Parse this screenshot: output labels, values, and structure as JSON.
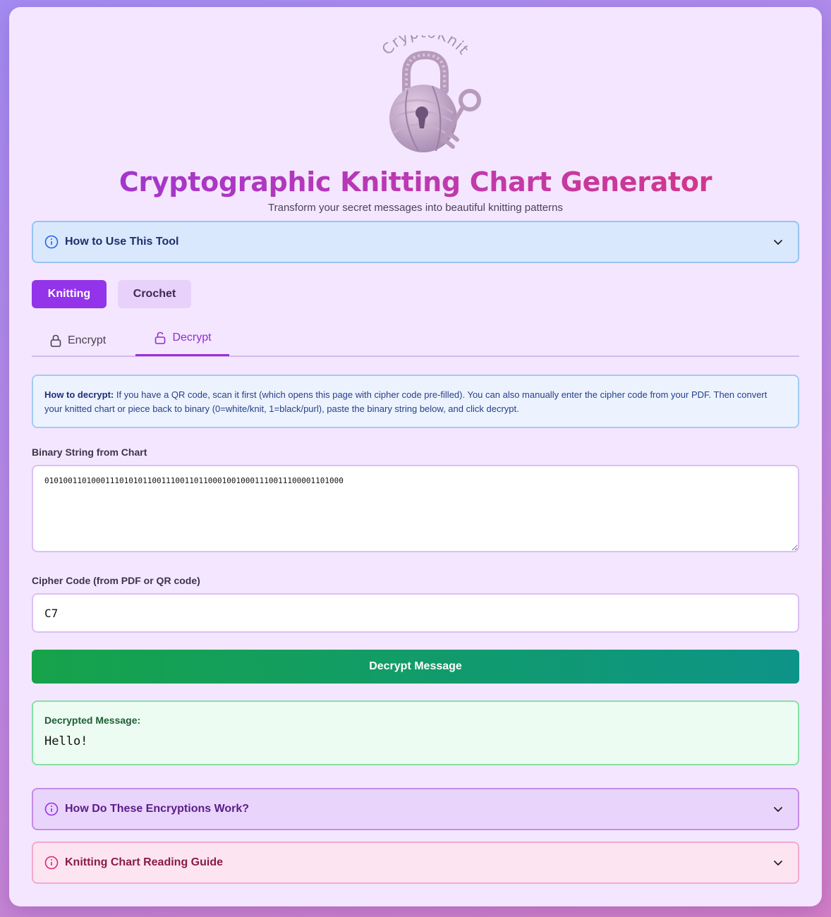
{
  "logo": {
    "text": "CryptoKnit"
  },
  "header": {
    "title": "Cryptographic Knitting Chart Generator",
    "subtitle": "Transform your secret messages into beautiful knitting patterns"
  },
  "how_to_use": {
    "label": "How to Use This Tool",
    "icon": "info-icon"
  },
  "modes": {
    "knitting": "Knitting",
    "crochet": "Crochet",
    "selected": "Knitting"
  },
  "tabs": {
    "encrypt": {
      "label": "Encrypt",
      "icon": "lock-icon"
    },
    "decrypt": {
      "label": "Decrypt",
      "icon": "unlock-icon"
    },
    "active": "Decrypt"
  },
  "help": {
    "title": "How to decrypt:",
    "text": "If you have a QR code, scan it first (which opens this page with cipher code pre-filled). You can also manually enter the cipher code from your PDF. Then convert your knitted chart or piece back to binary (0=white/knit, 1=black/purl), paste the binary string below, and click decrypt."
  },
  "binary_field": {
    "label": "Binary String from Chart",
    "value": "0101001101000111010101100111001101100010010001110011100001101000"
  },
  "cipher_field": {
    "label": "Cipher Code (from PDF or QR code)",
    "value": "C7"
  },
  "decrypt_button": {
    "label": "Decrypt Message"
  },
  "result": {
    "label": "Decrypted Message:",
    "value": "Hello!"
  },
  "how_encryptions_work": {
    "label": "How Do These Encryptions Work?",
    "icon": "info-icon"
  },
  "reading_guide": {
    "label": "Knitting Chart Reading Guide",
    "icon": "info-icon"
  },
  "colors": {
    "primary": "#9333ea",
    "title_gradient": [
      "#9a35d7",
      "#d8357b"
    ],
    "success_gradient": [
      "#16a34a",
      "#0d9488"
    ]
  }
}
